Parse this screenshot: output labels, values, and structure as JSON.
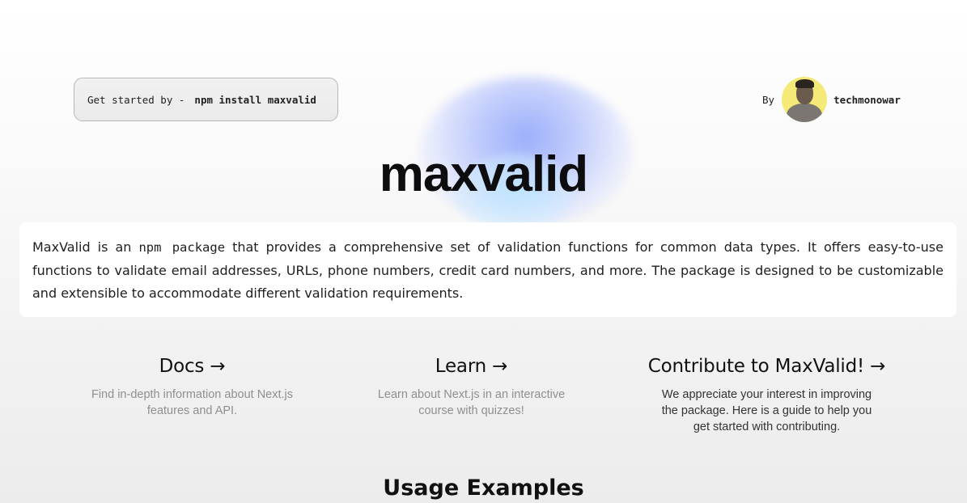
{
  "header": {
    "get_started_label": "Get started by -",
    "install_command": "npm install maxvalid",
    "by_label": "By",
    "author": "techmonowar"
  },
  "hero": {
    "title": "maxvalid"
  },
  "description": {
    "intro": "MaxValid is an ",
    "code": "npm package",
    "rest": " that provides a comprehensive set of validation functions for common data types. It offers easy-to-use functions to validate email addresses, URLs, phone numbers, credit card numbers, and more. The package is designed to be customizable and extensible to accommodate different validation requirements."
  },
  "cards": [
    {
      "title": "Docs →",
      "text": "Find in-depth information about Next.js features and API."
    },
    {
      "title": "Learn →",
      "text": "Learn about Next.js in an interactive course with quizzes!"
    },
    {
      "title": "Contribute to MaxValid! →",
      "text": "We appreciate your interest in improving the package. Here is a guide to help you get started with contributing."
    }
  ],
  "usage": {
    "heading": "Usage Examples"
  },
  "colors": {
    "accent_glow": "#a9b8fb",
    "avatar_bg": "#f5ea78"
  }
}
